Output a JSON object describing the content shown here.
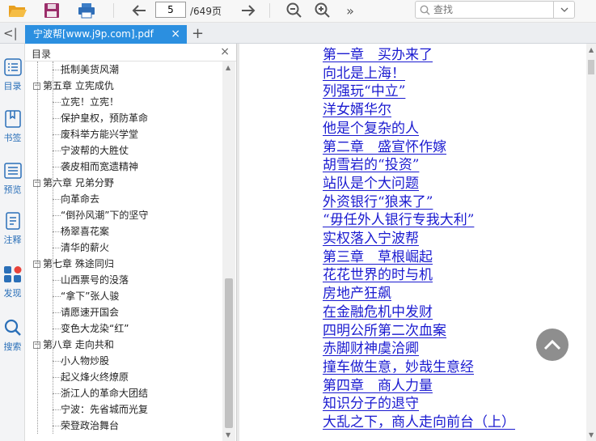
{
  "toolbar": {
    "page_current": "5",
    "page_total": "/649页",
    "search_placeholder": "查找"
  },
  "tab": {
    "title": "宁波帮[www.j9p.com].pdf",
    "close": "×",
    "add": "+"
  },
  "rail": [
    {
      "label": "目录",
      "icon": "toc-icon"
    },
    {
      "label": "书签",
      "icon": "bookmark-icon"
    },
    {
      "label": "预览",
      "icon": "preview-icon"
    },
    {
      "label": "注释",
      "icon": "annotation-icon"
    },
    {
      "label": "发现",
      "icon": "discover-icon"
    },
    {
      "label": "搜索",
      "icon": "search-icon"
    }
  ],
  "toc": {
    "title": "目录",
    "close": "×",
    "items": [
      {
        "text": "抵制美货风潮",
        "level": 2
      },
      {
        "text": "第五章 立宪成仇",
        "level": 1
      },
      {
        "text": "立宪！立宪！",
        "level": 2
      },
      {
        "text": "保护皇权，预防革命",
        "level": 2
      },
      {
        "text": "废科举方能兴学堂",
        "level": 2
      },
      {
        "text": "宁波帮的大胜仗",
        "level": 2
      },
      {
        "text": "袭皮相而宽遗精神",
        "level": 2
      },
      {
        "text": "第六章 兄弟分野",
        "level": 1
      },
      {
        "text": "向革命去",
        "level": 2
      },
      {
        "text": "“倒孙风潮”下的坚守",
        "level": 2
      },
      {
        "text": "杨翠喜花案",
        "level": 2
      },
      {
        "text": "清华的薪火",
        "level": 2
      },
      {
        "text": "第七章 殊途同归",
        "level": 1
      },
      {
        "text": "山西票号的没落",
        "level": 2
      },
      {
        "text": "“拿下”张人骏",
        "level": 2
      },
      {
        "text": "请愿速开国会",
        "level": 2
      },
      {
        "text": "变色大龙染“红”",
        "level": 2
      },
      {
        "text": "第八章 走向共和",
        "level": 1
      },
      {
        "text": "小人物炒股",
        "level": 2
      },
      {
        "text": "起义烽火终燎原",
        "level": 2
      },
      {
        "text": "浙江人的革命大团结",
        "level": 2
      },
      {
        "text": "宁波：先省城而光复",
        "level": 2
      },
      {
        "text": "荣登政治舞台",
        "level": 2
      }
    ]
  },
  "document": {
    "lines": [
      "第一章　买办来了",
      "向北是上海！",
      "列强玩“中立”",
      "洋女婿华尔",
      "他是个复杂的人",
      "第二章　盛宣怀作嫁",
      "胡雪岩的“投资”",
      "站队是个大问题",
      "外资银行“狼来了”",
      "“毋任外人银行专我大利”",
      "实权落入宁波帮",
      "第三章　草根崛起",
      "花花世界的时与机",
      "房地产狂飙",
      "在金融危机中发财",
      "四明公所第二次血案",
      "赤脚财神虞洽卿",
      "撞车做生意，妙哉生意经",
      "第四章　商人力量",
      "知识分子的退守",
      "大乱之下，商人走向前台（上）"
    ]
  },
  "colors": {
    "link": "#1a1ad0",
    "tab_active": "#2b8fe0",
    "rail_label": "#2a6fb8",
    "save_icon": "#9b2d6a",
    "folder_icon": "#f0a830"
  }
}
